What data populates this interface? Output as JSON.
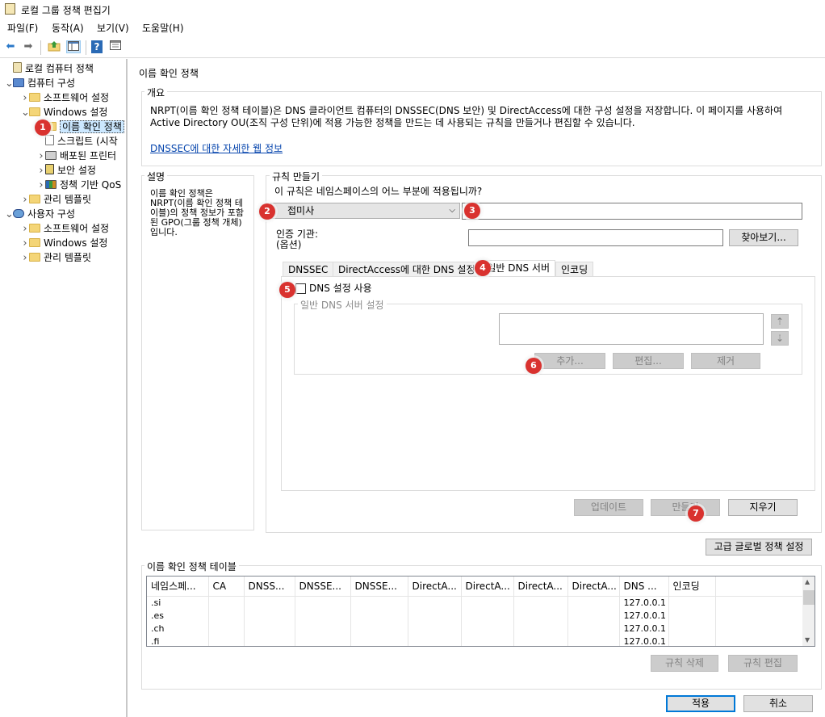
{
  "window": {
    "title": "로컬 그룹 정책 편집기"
  },
  "menubar": [
    "파일(F)",
    "동작(A)",
    "보기(V)",
    "도움말(H)"
  ],
  "toolbar": {
    "icons": [
      "back-arrow-icon",
      "forward-arrow-icon",
      "up-folder-icon",
      "show-hide-tree-icon",
      "help-icon",
      "properties-icon"
    ]
  },
  "tree": [
    {
      "label": "로컬 컴퓨터 정책",
      "icon": "policy-icon",
      "depth": 0,
      "arrow": ""
    },
    {
      "label": "컴퓨터 구성",
      "icon": "computer-icon",
      "depth": 0,
      "arrow": "v"
    },
    {
      "label": "소프트웨어 설정",
      "icon": "folder-icon",
      "depth": 1,
      "arrow": ">"
    },
    {
      "label": "Windows 설정",
      "icon": "folder-icon",
      "depth": 1,
      "arrow": "v"
    },
    {
      "label": "이름 확인 정책",
      "icon": "folder-icon",
      "depth": 2,
      "arrow": "",
      "selected": true
    },
    {
      "label": "스크립트 (시작",
      "icon": "script-icon",
      "depth": 2,
      "arrow": ""
    },
    {
      "label": "배포된 프린터",
      "icon": "printer-icon",
      "depth": 2,
      "arrow": ">"
    },
    {
      "label": "보안 설정",
      "icon": "security-icon",
      "depth": 2,
      "arrow": ">"
    },
    {
      "label": "정책 기반 QoS",
      "icon": "qos-chart-icon",
      "depth": 2,
      "arrow": ">"
    },
    {
      "label": "관리 템플릿",
      "icon": "folder-icon",
      "depth": 1,
      "arrow": ">"
    },
    {
      "label": "사용자 구성",
      "icon": "user-icon",
      "depth": 0,
      "arrow": "v"
    },
    {
      "label": "소프트웨어 설정",
      "icon": "folder-icon",
      "depth": 1,
      "arrow": ">"
    },
    {
      "label": "Windows 설정",
      "icon": "folder-icon",
      "depth": 1,
      "arrow": ">"
    },
    {
      "label": "관리 템플릿",
      "icon": "folder-icon",
      "depth": 1,
      "arrow": ">"
    }
  ],
  "content": {
    "title": "이름 확인 정책",
    "overview": {
      "label": "개요",
      "text": "NRPT(이름 확인 정책 테이블)은 DNS 클라이언트 컴퓨터의 DNSSEC(DNS 보안) 및 DirectAccess에 대한 구성 설정을 저장합니다. 이 페이지를 사용하여 Active Directory OU(조직 구성 단위)에 적용 가능한 정책을 만드는 데 사용되는 규칙을 만들거나 편집할 수 있습니다.",
      "link": "DNSSEC에 대한 자세한 웹 정보"
    },
    "description": {
      "label": "설명",
      "text": "이름 확인 정책은 NRPT(이름 확인 정책 테이블)의 정책 정보가 포함된 GPO(그룹 정책 개체)입니다."
    },
    "rules": {
      "label": "규칙 만들기",
      "question": "이 규칙은 네임스페이스의 어느 부분에 적용됩니까?",
      "namespace_type": "접미사",
      "namespace_value": "",
      "cert_label": "인증 기관:",
      "cert_optional": "(옵션)",
      "cert_value": "",
      "browse_label": "찾아보기...",
      "tabs": [
        "DNSSEC",
        "DirectAccess에 대한 DNS 설정",
        "일반 DNS 서버",
        "인코딩"
      ],
      "active_tab": 2,
      "enable_dns_label": "DNS 설정 사용",
      "enable_dns_checked": false,
      "dns_server_group_label": "일반 DNS 서버 설정",
      "add_label": "추가...",
      "edit_label": "편집...",
      "remove_label": "제거",
      "update_label": "업데이트",
      "create_label": "만들기",
      "clear_label": "지우기"
    },
    "advanced_global_label": "고급 글로벌 정책 설정",
    "nrpt": {
      "label": "이름 확인 정책 테이블",
      "columns": [
        "네임스페...",
        "CA",
        "DNSS...",
        "DNSSE...",
        "DNSSE...",
        "DirectA...",
        "DirectA...",
        "DirectA...",
        "DirectA...",
        "DNS ...",
        "인코딩"
      ],
      "rows": [
        [
          ".si",
          "",
          "",
          "",
          "",
          "",
          "",
          "",
          "",
          "127.0.0.1",
          ""
        ],
        [
          ".es",
          "",
          "",
          "",
          "",
          "",
          "",
          "",
          "",
          "127.0.0.1",
          ""
        ],
        [
          ".ch",
          "",
          "",
          "",
          "",
          "",
          "",
          "",
          "",
          "127.0.0.1",
          ""
        ],
        [
          ".fi",
          "",
          "",
          "",
          "",
          "",
          "",
          "",
          "",
          "127.0.0.1",
          ""
        ]
      ],
      "delete_label": "규칙 삭제",
      "edit_rule_label": "규칙 편집"
    },
    "apply_label": "적용",
    "cancel_label": "취소"
  },
  "annotations": [
    "1",
    "2",
    "3",
    "4",
    "5",
    "6",
    "7"
  ]
}
